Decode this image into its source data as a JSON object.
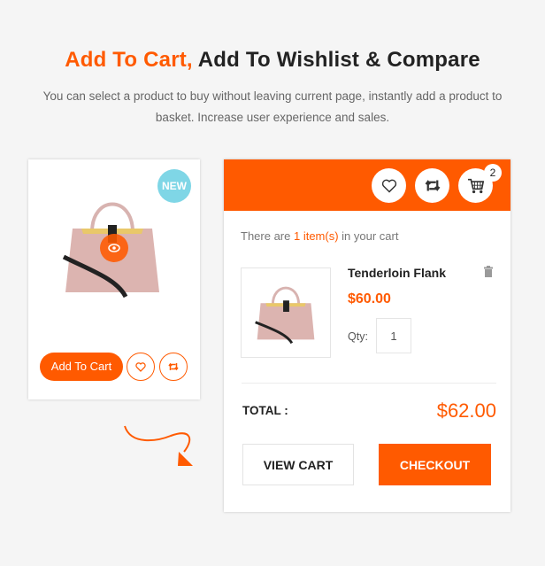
{
  "header": {
    "title_accent": "Add To Cart,",
    "title_rest": " Add To Wishlist & Compare",
    "subtitle": "You can select a product to buy without leaving current page, instantly add a product to basket. Increase user experience and sales."
  },
  "product_card": {
    "badge": "NEW",
    "add_to_cart_label": "Add To Cart",
    "icons": [
      "eye-icon",
      "heart-icon",
      "compare-icon"
    ]
  },
  "cart_panel": {
    "header_icons": [
      "heart-icon",
      "compare-icon",
      "cart-icon"
    ],
    "cart_count": "2",
    "message_prefix": "There are ",
    "message_count": "1 item(s)",
    "message_suffix": " in your cart",
    "item": {
      "name": "Tenderloin Flank",
      "price": "$60.00",
      "qty_label": "Qty:",
      "qty_value": "1"
    },
    "total_label": "TOTAL :",
    "total_value": "$62.00",
    "view_cart_label": "VIEW CART",
    "checkout_label": "CHECKOUT"
  },
  "colors": {
    "accent": "#ff5a00",
    "badge": "#7fd6e6",
    "background": "#f5f5f5"
  }
}
